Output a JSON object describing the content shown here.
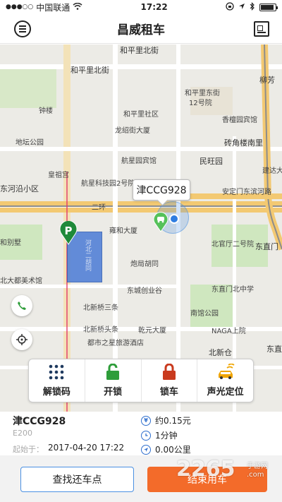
{
  "status_bar": {
    "signal": "●●●○○",
    "carrier": "中国联通",
    "time": "17:22"
  },
  "nav": {
    "title": "昌威租车"
  },
  "map": {
    "labels": [
      "和平里北街",
      "和平里北街",
      "和平里东街",
      "12号院",
      "和平里社区",
      "钟楼",
      "龙绍街大厦",
      "航星园宾馆",
      "航星科技园2号院",
      "地坛公园",
      "皇祖宫",
      "香檀园宾馆",
      "砖角楼南里",
      "民旺园",
      "建达大",
      "东河沿小区",
      "二环",
      "安定门东滨河路",
      "雍和大厦",
      "炮局胡同",
      "北官厅二号院",
      "东直门北中学",
      "东城创业谷",
      "南馆公园",
      "NAGA上院",
      "北新桥三条",
      "北新桥头条",
      "都市之星旅游酒店",
      "乾元大厦",
      "北新仓",
      "和别墅",
      "北大都美术馆",
      "柳芳",
      "东直门",
      "东直"
    ],
    "callout_plate": "津CCG928",
    "parking_symbol": "P",
    "area_text": "河北二胡同"
  },
  "actions": [
    {
      "label": "解锁码",
      "icon": "dots-grid-icon",
      "color": "#1f3a5f"
    },
    {
      "label": "开锁",
      "icon": "unlock-icon",
      "color": "#2e9d3a"
    },
    {
      "label": "锁车",
      "icon": "lock-icon",
      "color": "#c93a1e"
    },
    {
      "label": "声光定位",
      "icon": "car-signal-icon",
      "color": "#f0a500"
    }
  ],
  "info": {
    "plate": "津CCG928",
    "model": "E200",
    "start_label": "起始于：",
    "start_time": "2017-04-20 17:22",
    "price": "约0.15元",
    "duration": "1分钟",
    "distance": "0.00公里",
    "price_icon_text": "¥"
  },
  "bottom": {
    "find_label": "查找还车点",
    "end_label": "结束用车"
  },
  "watermark": {
    "main": "2265",
    "sub1": "手游网",
    "sub2": ".com"
  },
  "colors": {
    "accent_orange": "#f36b2a",
    "accent_blue": "#4a90e2",
    "green": "#2e9d3a",
    "red": "#c93a1e",
    "yellow": "#f0a500"
  }
}
